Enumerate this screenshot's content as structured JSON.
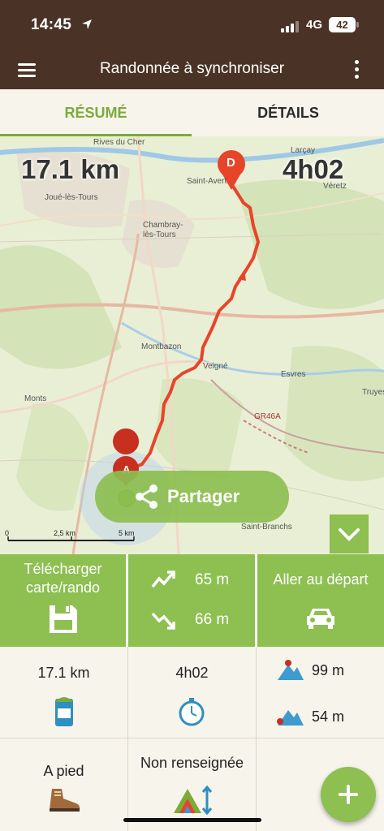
{
  "status_bar": {
    "time": "14:45",
    "network": "4G",
    "battery": "42"
  },
  "app_bar": {
    "title": "Randonnée à synchroniser"
  },
  "tabs": [
    {
      "label": "RÉSUMÉ",
      "active": true
    },
    {
      "label": "DÉTAILS",
      "active": false
    }
  ],
  "map": {
    "distance": "17.1 km",
    "duration": "4h02",
    "place_labels": [
      "Rives du Cher",
      "Larçay",
      "Saint-Avert",
      "Véretz",
      "Joué-lès-Tours",
      "Chambray-lès-Tours",
      "Montbazon",
      "Veigné",
      "Esvres",
      "Truyes",
      "Monts",
      "GR46A",
      "Saint-Branchs"
    ],
    "start_marker": "A",
    "end_marker": "D",
    "share_label": "Partager",
    "scale_labels": [
      "0",
      "2,5 km",
      "5 km"
    ]
  },
  "actions": {
    "download_label": "Télécharger\ncarte/rando",
    "elevation_gain": "65 m",
    "elevation_loss": "66 m",
    "go_to_start_label": "Aller au départ"
  },
  "stats": {
    "distance": "17.1 km",
    "duration": "4h02",
    "max_altitude": "99 m",
    "min_altitude": "54 m",
    "activity": "A pied",
    "difficulty": "Non renseignée"
  },
  "colors": {
    "brand_brown": "#4a3326",
    "accent_green": "#8dbf51",
    "tab_green": "#7cab3a",
    "track_red": "#e8442a"
  }
}
